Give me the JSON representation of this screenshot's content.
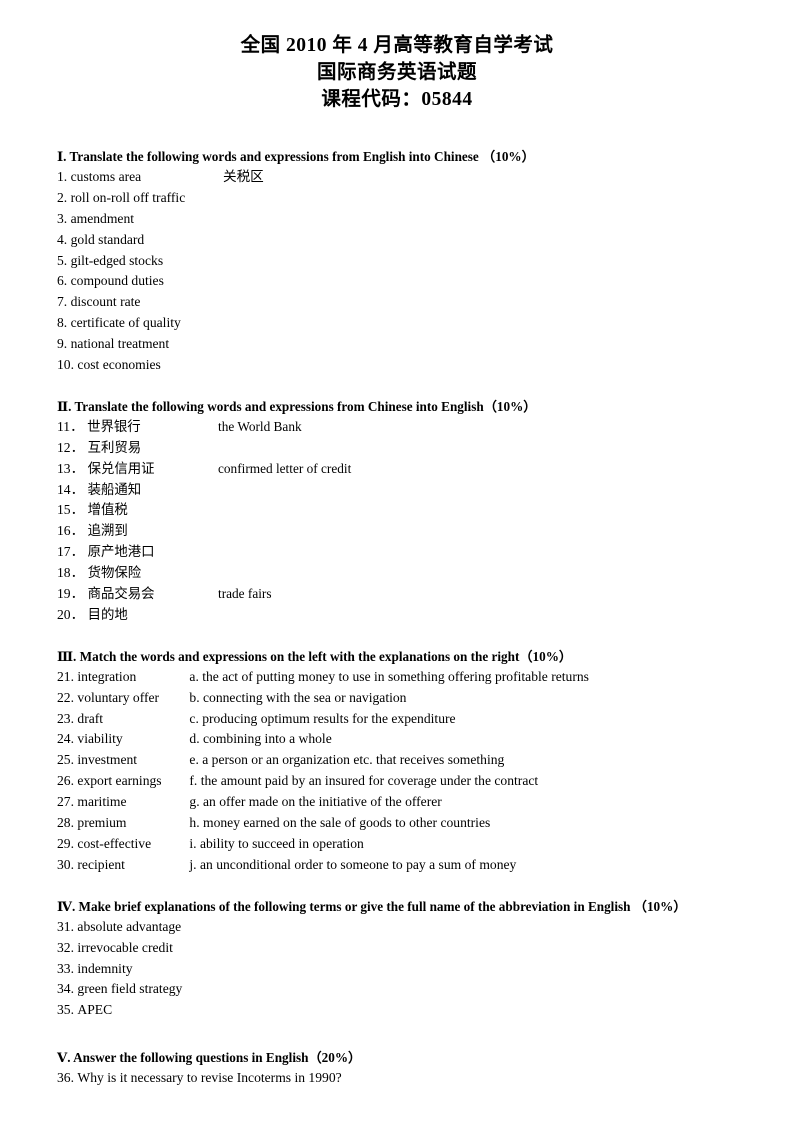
{
  "document": {
    "title_lines": [
      "全国 2010 年 4 月高等教育自学考试",
      "国际商务英语试题",
      "课程代码：05844"
    ]
  },
  "sections": [
    {
      "numeral": "Ⅰ",
      "heading": "Ⅰ. Translate the following words and expressions from English into Chinese  （10%）",
      "items": [
        {
          "num": "1.",
          "term": "customs area",
          "answer": "关税区"
        },
        {
          "num": "2.",
          "term": "roll on-roll off traffic",
          "answer": ""
        },
        {
          "num": "3.",
          "term": "amendment",
          "answer": ""
        },
        {
          "num": "4.",
          "term": "gold standard",
          "answer": ""
        },
        {
          "num": "5.",
          "term": "gilt-edged stocks",
          "answer": ""
        },
        {
          "num": "6.",
          "term": "compound duties",
          "answer": ""
        },
        {
          "num": "7.",
          "term": "discount rate",
          "answer": ""
        },
        {
          "num": "8.",
          "term": "certificate of quality",
          "answer": ""
        },
        {
          "num": "9.",
          "term": "national treatment",
          "answer": ""
        },
        {
          "num": "10.",
          "term": "cost economies",
          "answer": ""
        }
      ]
    },
    {
      "numeral": "Ⅱ",
      "heading": "Ⅱ. Translate the following words and expressions from Chinese into English（10%）",
      "items": [
        {
          "num": "11．",
          "term": "世界银行",
          "answer": "the World Bank"
        },
        {
          "num": "12．",
          "term": "互利贸易",
          "answer": ""
        },
        {
          "num": "13．",
          "term": "保兑信用证",
          "answer": "confirmed letter of credit"
        },
        {
          "num": "14．",
          "term": "装船通知",
          "answer": ""
        },
        {
          "num": "15．",
          "term": "增值税",
          "answer": ""
        },
        {
          "num": "16．",
          "term": "追溯到",
          "answer": ""
        },
        {
          "num": "17．",
          "term": "原产地港口",
          "answer": ""
        },
        {
          "num": "18．",
          "term": "货物保险",
          "answer": ""
        },
        {
          "num": "19．",
          "term": "商品交易会",
          "answer": "trade fairs"
        },
        {
          "num": "20．",
          "term": "目的地",
          "answer": ""
        }
      ]
    },
    {
      "numeral": "Ⅲ",
      "heading": "Ⅲ. Match the words and expressions on the left with the explanations on the right（10%）",
      "items": [
        {
          "num": "21.",
          "term": "integration",
          "explanation": "a. the act of putting money to use in something offering profitable returns"
        },
        {
          "num": "22.",
          "term": "voluntary offer",
          "explanation": "b. connecting with the sea or navigation"
        },
        {
          "num": "23.",
          "term": "draft",
          "explanation": "c. producing optimum results for the expenditure"
        },
        {
          "num": "24.",
          "term": "viability",
          "explanation": "d. combining into a whole"
        },
        {
          "num": "25.",
          "term": "investment",
          "explanation": "e. a person or an organization etc. that receives something"
        },
        {
          "num": "26.",
          "term": "export earnings",
          "explanation": "f. the amount paid by an insured for coverage under the contract"
        },
        {
          "num": "27.",
          "term": "maritime",
          "explanation": "g. an offer made on the initiative of the offerer"
        },
        {
          "num": "28.",
          "term": "premium",
          "explanation": "h. money earned on the sale of goods to other countries"
        },
        {
          "num": "29.",
          "term": "cost-effective",
          "explanation": "i. ability to succeed in operation"
        },
        {
          "num": "30.",
          "term": "recipient",
          "explanation": "j. an unconditional order to someone to pay a sum of money"
        }
      ]
    },
    {
      "numeral": "Ⅳ",
      "heading": "Ⅳ. Make brief explanations of the following terms or give the full name of the abbreviation in English  （10%）",
      "items": [
        {
          "num": "31.",
          "term": "absolute advantage"
        },
        {
          "num": "32.",
          "term": "irrevocable credit"
        },
        {
          "num": "33.",
          "term": "indemnity"
        },
        {
          "num": "34.",
          "term": "green field strategy"
        },
        {
          "num": "35.",
          "term": "APEC"
        }
      ]
    },
    {
      "numeral": "Ⅴ",
      "heading": "Ⅴ. Answer the following questions in English（20%）",
      "items": [
        {
          "num": "36.",
          "term": "Why is it necessary to revise Incoterms in 1990?"
        }
      ]
    }
  ]
}
